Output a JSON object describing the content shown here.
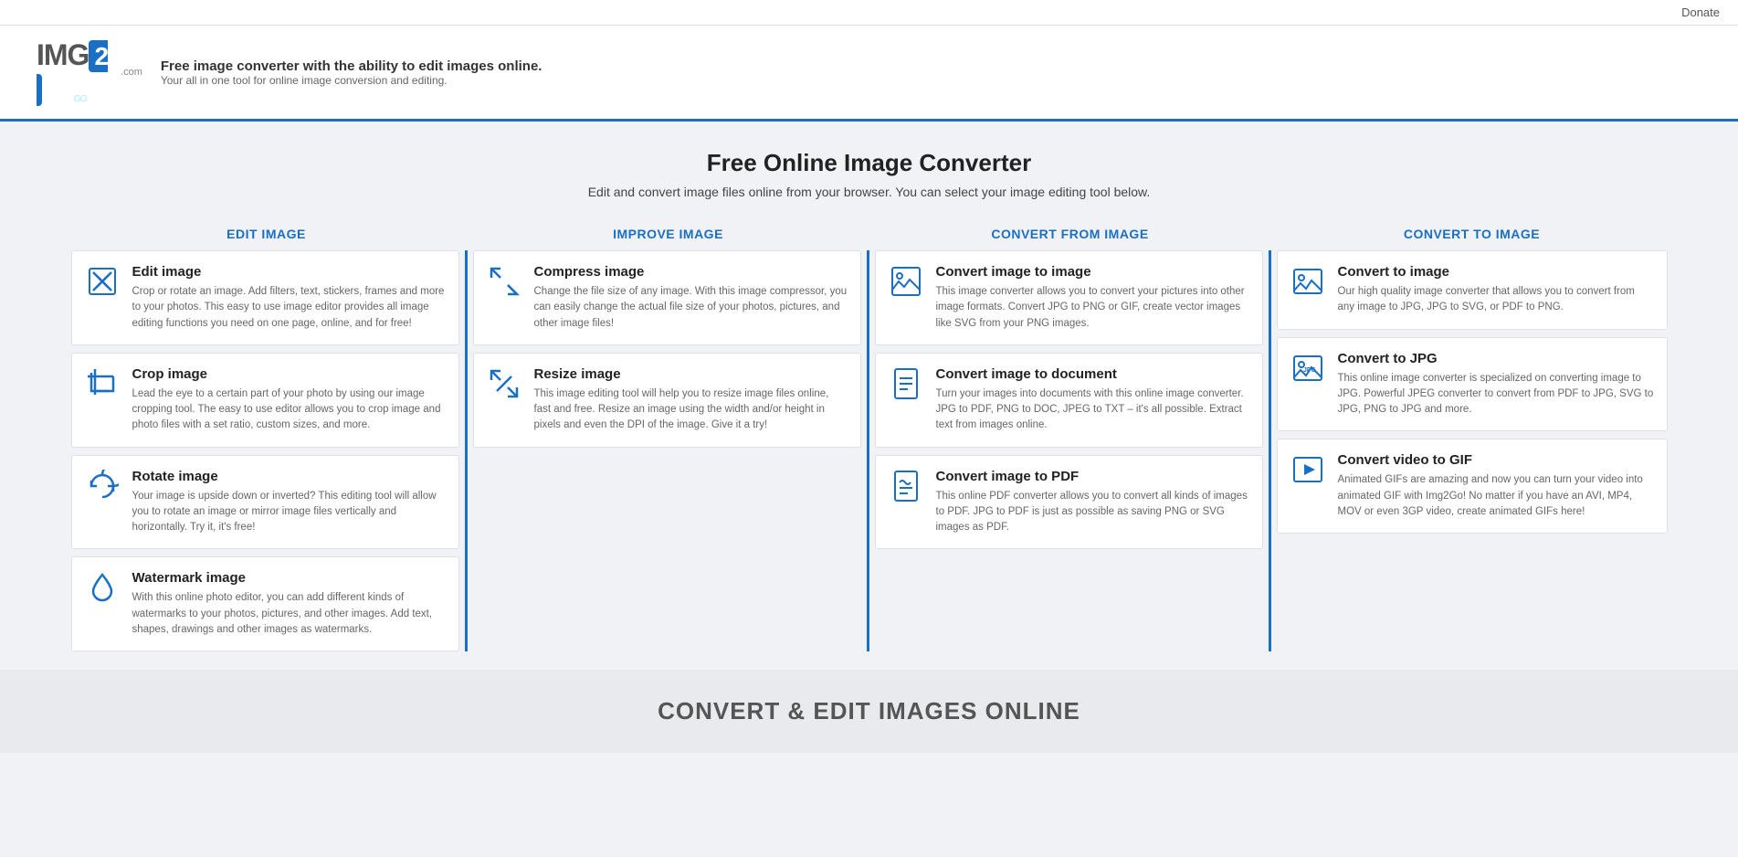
{
  "topbar": {
    "donate_label": "Donate"
  },
  "header": {
    "logo_img": "IMG",
    "logo_2": "2",
    "logo_go": "GO",
    "logo_com": ".com",
    "tagline_title": "Free image converter with the ability to edit images online.",
    "tagline_sub": "Your all in one tool for online image conversion and editing."
  },
  "hero": {
    "title": "Free Online Image Converter",
    "subtitle": "Edit and convert image files online from your browser. You can select your image editing tool below."
  },
  "categories": [
    {
      "label": "EDIT IMAGE"
    },
    {
      "label": "IMPROVE IMAGE"
    },
    {
      "label": "CONVERT FROM IMAGE"
    },
    {
      "label": "CONVERT TO IMAGE"
    }
  ],
  "columns": [
    {
      "id": "edit",
      "cards": [
        {
          "icon": "edit-icon",
          "title": "Edit image",
          "desc": "Crop or rotate an image. Add filters, text, stickers, frames and more to your photos. This easy to use image editor provides all image editing functions you need on one page, online, and for free!"
        },
        {
          "icon": "crop-icon",
          "title": "Crop image",
          "desc": "Lead the eye to a certain part of your photo by using our image cropping tool. The easy to use editor allows you to crop image and photo files with a set ratio, custom sizes, and more."
        },
        {
          "icon": "rotate-icon",
          "title": "Rotate image",
          "desc": "Your image is upside down or inverted? This editing tool will allow you to rotate an image or mirror image files vertically and horizontally. Try it, it's free!"
        },
        {
          "icon": "watermark-icon",
          "title": "Watermark image",
          "desc": "With this online photo editor, you can add different kinds of watermarks to your photos, pictures, and other images. Add text, shapes, drawings and other images as watermarks."
        }
      ]
    },
    {
      "id": "improve",
      "cards": [
        {
          "icon": "compress-icon",
          "title": "Compress image",
          "desc": "Change the file size of any image. With this image compressor, you can easily change the actual file size of your photos, pictures, and other image files!"
        },
        {
          "icon": "resize-icon",
          "title": "Resize image",
          "desc": "This image editing tool will help you to resize image files online, fast and free. Resize an image using the width and/or height in pixels and even the DPI of the image. Give it a try!"
        }
      ]
    },
    {
      "id": "convert-from",
      "cards": [
        {
          "icon": "convert-image-icon",
          "title": "Convert image to image",
          "desc": "This image converter allows you to convert your pictures into other image formats. Convert JPG to PNG or GIF, create vector images like SVG from your PNG images."
        },
        {
          "icon": "convert-doc-icon",
          "title": "Convert image to document",
          "desc": "Turn your images into documents with this online image converter. JPG to PDF, PNG to DOC, JPEG to TXT – it's all possible. Extract text from images online."
        },
        {
          "icon": "convert-pdf-icon",
          "title": "Convert image to PDF",
          "desc": "This online PDF converter allows you to convert all kinds of images to PDF. JPG to PDF is just as possible as saving PNG or SVG images as PDF."
        }
      ]
    },
    {
      "id": "convert-to",
      "cards": [
        {
          "icon": "to-image-icon",
          "title": "Convert to image",
          "desc": "Our high quality image converter that allows you to convert from any image to JPG, JPG to SVG, or PDF to PNG."
        },
        {
          "icon": "to-jpg-icon",
          "title": "Convert to JPG",
          "desc": "This online image converter is specialized on converting image to JPG. Powerful JPEG converter to convert from PDF to JPG, SVG to JPG, PNG to JPG and more."
        },
        {
          "icon": "to-gif-icon",
          "title": "Convert video to GIF",
          "desc": "Animated GIFs are amazing and now you can turn your video into animated GIF with Img2Go! No matter if you have an AVI, MP4, MOV or even 3GP video, create animated GIFs here!"
        }
      ]
    }
  ],
  "footer": {
    "title": "CONVERT & EDIT IMAGES ONLINE"
  }
}
